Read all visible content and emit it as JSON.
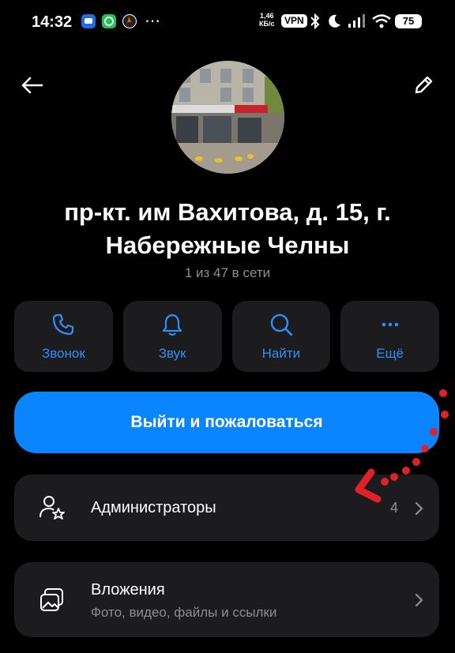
{
  "status_bar": {
    "time": "14:32",
    "speed_value": "1,46",
    "speed_unit": "КБ/с",
    "vpn": "VPN",
    "battery": "75",
    "icons": [
      "messages-icon",
      "whatsapp-icon",
      "compass-icon",
      "more-icon",
      "bluetooth-icon",
      "moon-icon",
      "signal-icon",
      "wifi-icon"
    ]
  },
  "header": {
    "back_icon": "arrow-left-icon",
    "edit_icon": "pencil-icon"
  },
  "profile": {
    "title": "пр-кт. им Вахитова, д. 15, г. Набережные Челны",
    "subtitle": "1 из 47 в сети"
  },
  "actions": [
    {
      "label": "Звонок",
      "icon": "phone-icon"
    },
    {
      "label": "Звук",
      "icon": "bell-icon"
    },
    {
      "label": "Найти",
      "icon": "search-icon"
    },
    {
      "label": "Ещё",
      "icon": "more-dots-icon"
    }
  ],
  "leave_button": {
    "label": "Выйти и пожаловаться"
  },
  "admins": {
    "title": "Администраторы",
    "count": "4",
    "icon": "admin-star-icon"
  },
  "media": {
    "title": "Вложения",
    "subtitle": "Фото, видео, файлы и ссылки",
    "icon": "gallery-icon"
  },
  "colors": {
    "accent": "#0a84ff",
    "action_text": "#2f8ff5",
    "card_bg": "#1c1c1e",
    "annotation": "#e0202a"
  }
}
